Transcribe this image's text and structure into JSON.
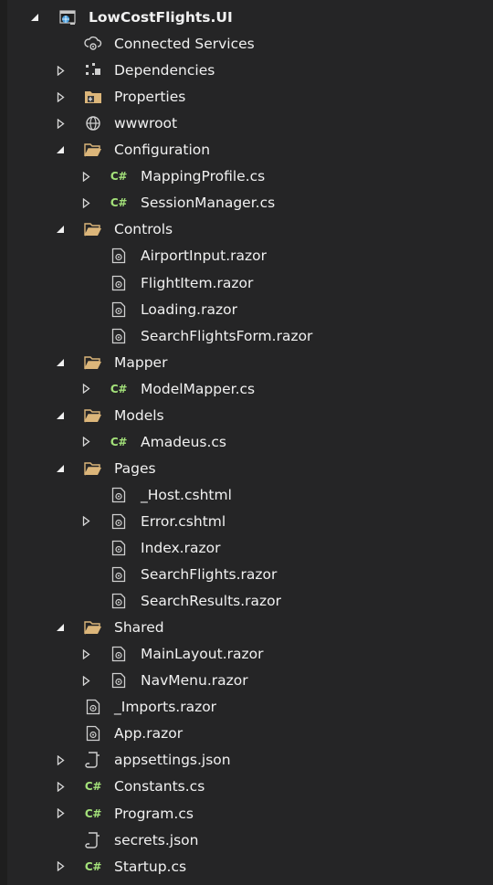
{
  "tree": [
    {
      "label": "LowCostFlights.UI",
      "icon": "project-icon",
      "depth": 0,
      "arrow": "expanded",
      "bold": true
    },
    {
      "label": "Connected Services",
      "icon": "connected-services-icon",
      "depth": 1,
      "arrow": "none"
    },
    {
      "label": "Dependencies",
      "icon": "dependencies-icon",
      "depth": 1,
      "arrow": "collapsed"
    },
    {
      "label": "Properties",
      "icon": "properties-icon",
      "depth": 1,
      "arrow": "collapsed"
    },
    {
      "label": "wwwroot",
      "icon": "globe-icon",
      "depth": 1,
      "arrow": "collapsed"
    },
    {
      "label": "Configuration",
      "icon": "folder-open-icon",
      "depth": 1,
      "arrow": "expanded"
    },
    {
      "label": "MappingProfile.cs",
      "icon": "csharp-file-icon",
      "depth": 2,
      "arrow": "collapsed"
    },
    {
      "label": "SessionManager.cs",
      "icon": "csharp-file-icon",
      "depth": 2,
      "arrow": "collapsed"
    },
    {
      "label": "Controls",
      "icon": "folder-open-icon",
      "depth": 1,
      "arrow": "expanded"
    },
    {
      "label": "AirportInput.razor",
      "icon": "razor-file-icon",
      "depth": 2,
      "arrow": "none"
    },
    {
      "label": "FlightItem.razor",
      "icon": "razor-file-icon",
      "depth": 2,
      "arrow": "none"
    },
    {
      "label": "Loading.razor",
      "icon": "razor-file-icon",
      "depth": 2,
      "arrow": "none"
    },
    {
      "label": "SearchFlightsForm.razor",
      "icon": "razor-file-icon",
      "depth": 2,
      "arrow": "none"
    },
    {
      "label": "Mapper",
      "icon": "folder-open-icon",
      "depth": 1,
      "arrow": "expanded"
    },
    {
      "label": "ModelMapper.cs",
      "icon": "csharp-file-icon",
      "depth": 2,
      "arrow": "collapsed"
    },
    {
      "label": "Models",
      "icon": "folder-open-icon",
      "depth": 1,
      "arrow": "expanded"
    },
    {
      "label": "Amadeus.cs",
      "icon": "csharp-file-icon",
      "depth": 2,
      "arrow": "collapsed"
    },
    {
      "label": "Pages",
      "icon": "folder-open-icon",
      "depth": 1,
      "arrow": "expanded"
    },
    {
      "label": "_Host.cshtml",
      "icon": "razor-file-icon",
      "depth": 2,
      "arrow": "none"
    },
    {
      "label": "Error.cshtml",
      "icon": "razor-file-icon",
      "depth": 2,
      "arrow": "collapsed"
    },
    {
      "label": "Index.razor",
      "icon": "razor-file-icon",
      "depth": 2,
      "arrow": "none"
    },
    {
      "label": "SearchFlights.razor",
      "icon": "razor-file-icon",
      "depth": 2,
      "arrow": "none"
    },
    {
      "label": "SearchResults.razor",
      "icon": "razor-file-icon",
      "depth": 2,
      "arrow": "none"
    },
    {
      "label": "Shared",
      "icon": "folder-open-icon",
      "depth": 1,
      "arrow": "expanded"
    },
    {
      "label": "MainLayout.razor",
      "icon": "razor-file-icon",
      "depth": 2,
      "arrow": "collapsed"
    },
    {
      "label": "NavMenu.razor",
      "icon": "razor-file-icon",
      "depth": 2,
      "arrow": "collapsed"
    },
    {
      "label": "_Imports.razor",
      "icon": "razor-file-icon",
      "depth": 1,
      "arrow": "none"
    },
    {
      "label": "App.razor",
      "icon": "razor-file-icon",
      "depth": 1,
      "arrow": "none"
    },
    {
      "label": "appsettings.json",
      "icon": "json-file-icon",
      "depth": 1,
      "arrow": "collapsed"
    },
    {
      "label": "Constants.cs",
      "icon": "csharp-file-icon",
      "depth": 1,
      "arrow": "collapsed"
    },
    {
      "label": "Program.cs",
      "icon": "csharp-file-icon",
      "depth": 1,
      "arrow": "collapsed"
    },
    {
      "label": "secrets.json",
      "icon": "json-file-icon",
      "depth": 1,
      "arrow": "none"
    },
    {
      "label": "Startup.cs",
      "icon": "csharp-file-icon",
      "depth": 1,
      "arrow": "collapsed"
    }
  ],
  "colors": {
    "background": "#252526",
    "text": "#f1f1f1",
    "folder": "#dcb67a",
    "csharp": "#a4e27a",
    "project": "#4aa0e0"
  }
}
